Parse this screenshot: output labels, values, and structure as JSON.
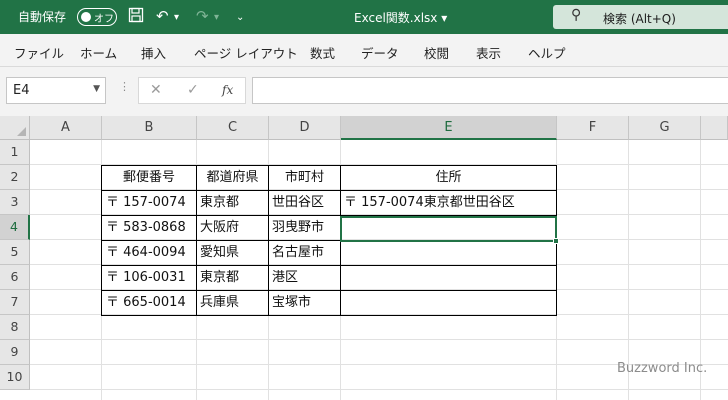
{
  "titlebar": {
    "autosave_label": "自動保存",
    "autosave_state": "オフ",
    "filename": "Excel関数.xlsx",
    "filename_arrow": "▾",
    "search_label": "検索 (Alt+Q)"
  },
  "ribbon": {
    "tabs": [
      "ファイル",
      "ホーム",
      "挿入",
      "ページ レイアウト",
      "数式",
      "データ",
      "校閲",
      "表示",
      "ヘルプ"
    ]
  },
  "formula_bar": {
    "name_box": "E4",
    "fx": "fx",
    "value": ""
  },
  "grid": {
    "columns": [
      "A",
      "B",
      "C",
      "D",
      "E",
      "F",
      "G"
    ],
    "rows": [
      "1",
      "2",
      "3",
      "4",
      "5",
      "6",
      "7",
      "8",
      "9",
      "10"
    ],
    "selected_column": "E",
    "selected_row": "4"
  },
  "table": {
    "headers": [
      "郵便番号",
      "都道府県",
      "市町村",
      "住所"
    ],
    "rows": [
      [
        "〒 157-0074",
        "東京都",
        "世田谷区",
        "〒 157-0074東京都世田谷区"
      ],
      [
        "〒 583-0868",
        "大阪府",
        "羽曳野市",
        ""
      ],
      [
        "〒 464-0094",
        "愛知県",
        "名古屋市",
        ""
      ],
      [
        "〒 106-0031",
        "東京都",
        "港区",
        ""
      ],
      [
        "〒 665-0014",
        "兵庫県",
        "宝塚市",
        ""
      ]
    ]
  },
  "watermark": "Buzzword Inc.",
  "colors": {
    "accent": "#217346"
  }
}
